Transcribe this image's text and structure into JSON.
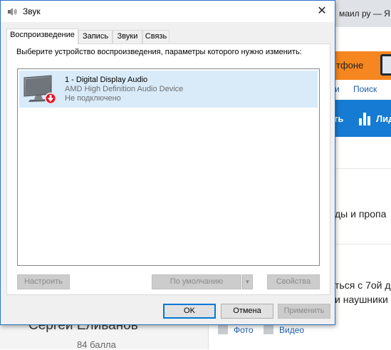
{
  "background": {
    "tab_title": "маил ру — Я",
    "banner_text": "тфоне",
    "links": [
      "и",
      "Поиск"
    ],
    "blue_bar": {
      "left_text": "ть",
      "right_text": "Лид"
    },
    "text_line_1": "ды и пропа",
    "text_line_2": "ться с 7ой д",
    "text_line_3": "и наушники",
    "author_name": "Сергей Еливанов",
    "author_points": "84 балла",
    "media_links": {
      "photo": "Фото",
      "video": "Видео"
    },
    "accent": "#f6861f",
    "blue": "#167bd2"
  },
  "dialog": {
    "title": "Звук",
    "close_glyph": "✕",
    "tabs": [
      {
        "label": "Воспроизведение",
        "active": true
      },
      {
        "label": "Запись",
        "active": false
      },
      {
        "label": "Звуки",
        "active": false
      },
      {
        "label": "Связь",
        "active": false
      }
    ],
    "instruction": "Выберите устройство воспроизведения, параметры которого нужно изменить:",
    "devices": [
      {
        "name": "1 - Digital Display Audio",
        "driver": "AMD High Definition Audio Device",
        "status": "Не подключено",
        "icon": "monitor-disconnected-icon",
        "selected": true
      }
    ],
    "buttons": {
      "configure": "Настроить",
      "set_default": "По умолчанию",
      "set_default_arrow": "▼",
      "properties": "Свойства",
      "ok": "OK",
      "cancel": "Отмена",
      "apply": "Применить"
    },
    "colors": {
      "border": "#2b73c9",
      "selection": "#d9ebf9",
      "default_button_border": "#0078d7",
      "status_red": "#e81123"
    }
  }
}
